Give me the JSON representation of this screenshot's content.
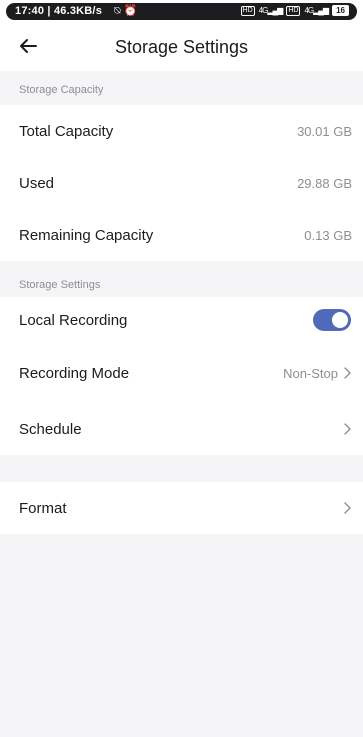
{
  "status_bar": {
    "time": "17:40",
    "speed": "46.3KB/s",
    "sys_icons": "⍉ ⏰",
    "hd1": "HD",
    "net1": "4G",
    "hd2": "HD",
    "net2": "4G",
    "battery": "16"
  },
  "header": {
    "title": "Storage Settings"
  },
  "capacity_section": {
    "label": "Storage Capacity",
    "rows": [
      {
        "label": "Total Capacity",
        "value": "30.01 GB"
      },
      {
        "label": "Used",
        "value": "29.88 GB"
      },
      {
        "label": "Remaining Capacity",
        "value": "0.13 GB"
      }
    ]
  },
  "settings_section": {
    "label": "Storage Settings",
    "local_recording": {
      "label": "Local Recording",
      "enabled": true
    },
    "recording_mode": {
      "label": "Recording Mode",
      "value": "Non-Stop"
    },
    "schedule": {
      "label": "Schedule"
    }
  },
  "format": {
    "label": "Format"
  },
  "colors": {
    "accent": "#4f6ab8",
    "background": "#f5f5f7",
    "secondary_text": "#8e8e93"
  }
}
